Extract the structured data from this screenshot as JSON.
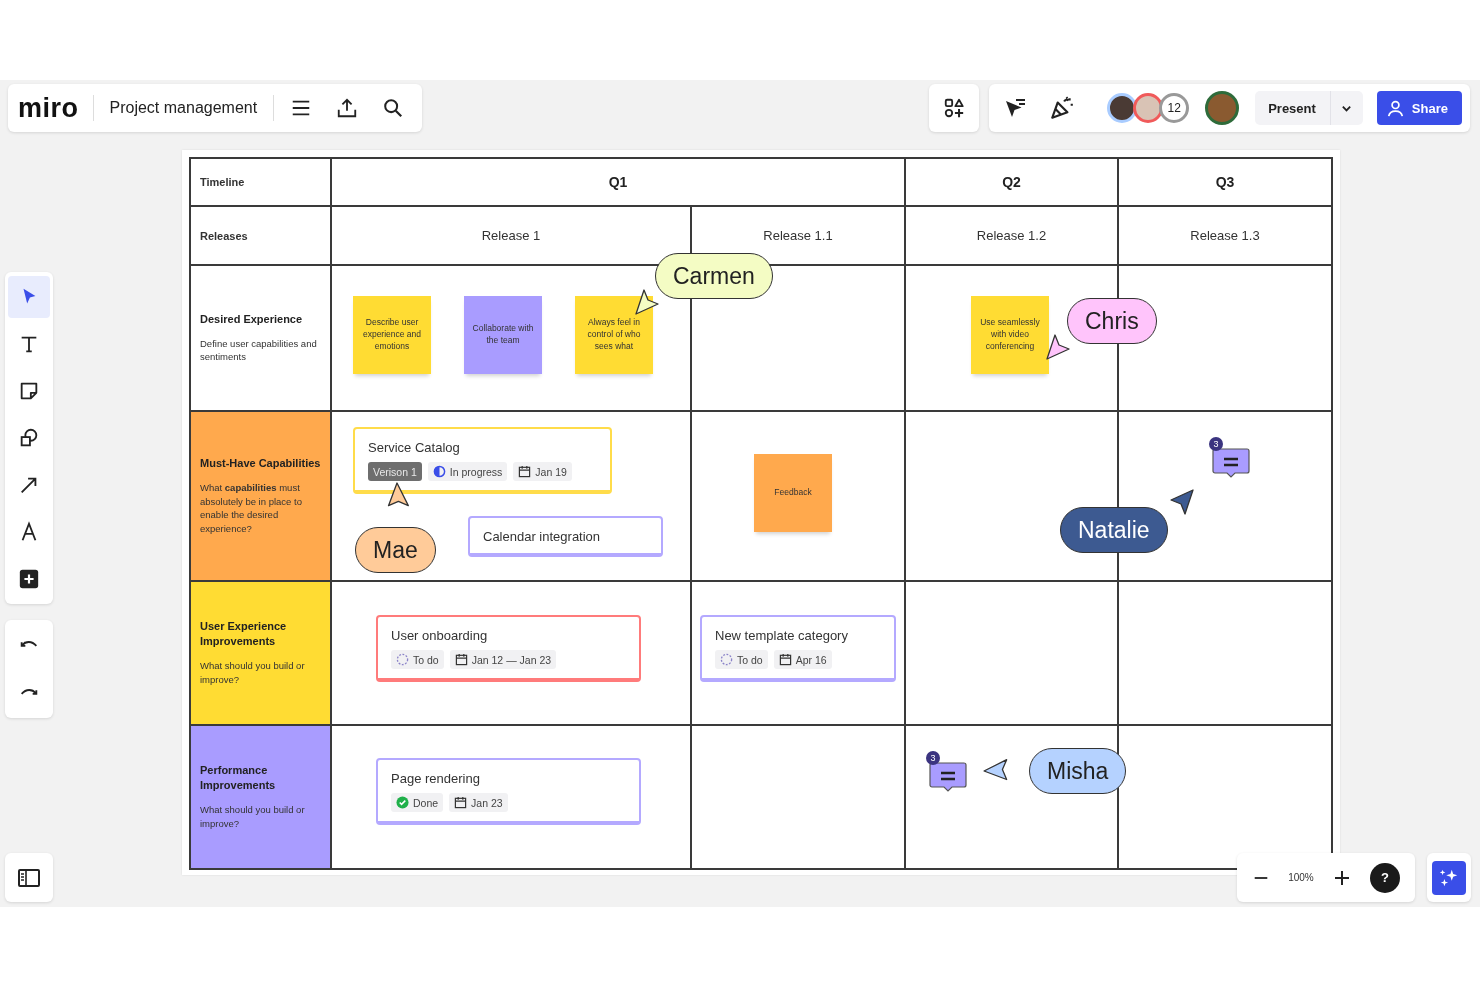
{
  "app": {
    "logo": "miro",
    "board_title": "Project management"
  },
  "collaborators": {
    "count": "12"
  },
  "buttons": {
    "present": "Present",
    "share": "Share"
  },
  "tools": [
    {
      "kind": "select",
      "selected": true
    },
    {
      "kind": "text",
      "selected": false
    },
    {
      "kind": "sticky",
      "selected": false
    },
    {
      "kind": "shapes",
      "selected": false
    },
    {
      "kind": "line",
      "selected": false
    },
    {
      "kind": "pen",
      "selected": false
    },
    {
      "kind": "add",
      "selected": false
    }
  ],
  "zoom": {
    "level_text": "100%",
    "help": "?"
  },
  "table": {
    "timeline_label": "Timeline",
    "releases_label": "Releases",
    "quarters": [
      {
        "label": "Q1",
        "releases": [
          "Release 1",
          "Release 1.1"
        ]
      },
      {
        "label": "Q2",
        "releases": [
          "Release 1.2"
        ]
      },
      {
        "label": "Q3",
        "releases": [
          "Release 1.3"
        ]
      }
    ],
    "rows": [
      {
        "title": "Desired Experience",
        "description": "Define user capabilities and sentiments",
        "color": "#ffffff"
      },
      {
        "title": "Must-Have Capabilities",
        "description": "What **capabilities** must absolutely be in place to enable the desired experience?",
        "color": "#ffa94d"
      },
      {
        "title": "User Experience Improvements",
        "description": "What should you build or improve?",
        "color": "#ffdc33"
      },
      {
        "title": "Performance Improvements",
        "description": "What should you build or improve?",
        "color": "#a99cff"
      }
    ]
  },
  "stickies": [
    {
      "text": "Describe user experience and emotions",
      "color": "#ffdc33"
    },
    {
      "text": "Collaborate with the team",
      "color": "#a99cff"
    },
    {
      "text": "Always feel in control of who sees what",
      "color": "#ffdc33"
    },
    {
      "text": "Use seamlessly with video conferencing",
      "color": "#ffdc33"
    },
    {
      "text": "Feedback",
      "color": "#ffa94d"
    }
  ],
  "cards": [
    {
      "title": "Service Catalog",
      "color": "#ffdc4a",
      "tags": [
        {
          "kind": "version",
          "text": "Verison 1"
        },
        {
          "kind": "in_progress",
          "text": "In progress"
        },
        {
          "kind": "date",
          "text": "Jan 19"
        }
      ]
    },
    {
      "title": "Calendar integration",
      "color": "#b4a9ff"
    },
    {
      "title": "User onboarding",
      "color": "#ff7b7b",
      "tags": [
        {
          "kind": "todo",
          "text": "To do"
        },
        {
          "kind": "date",
          "text": "Jan 12 — Jan 23"
        }
      ]
    },
    {
      "title": "New template category",
      "color": "#b4a9ff",
      "tags": [
        {
          "kind": "todo",
          "text": "To do"
        },
        {
          "kind": "date",
          "text": "Apr 16"
        }
      ]
    },
    {
      "title": "Page rendering",
      "color": "#b4a9ff",
      "tags": [
        {
          "kind": "done",
          "text": "Done"
        },
        {
          "kind": "date",
          "text": "Jan 23"
        }
      ]
    }
  ],
  "cursors": [
    {
      "name": "Carmen",
      "color": "#f4fcc4"
    },
    {
      "name": "Chris",
      "color": "#ffc4fb"
    },
    {
      "name": "Mae",
      "color": "#ffcb99"
    },
    {
      "name": "Natalie",
      "color": "#3d5a91"
    },
    {
      "name": "Misha",
      "color": "#b5d2ff"
    }
  ],
  "comments": [
    {
      "count": "3"
    },
    {
      "count": "3"
    }
  ]
}
